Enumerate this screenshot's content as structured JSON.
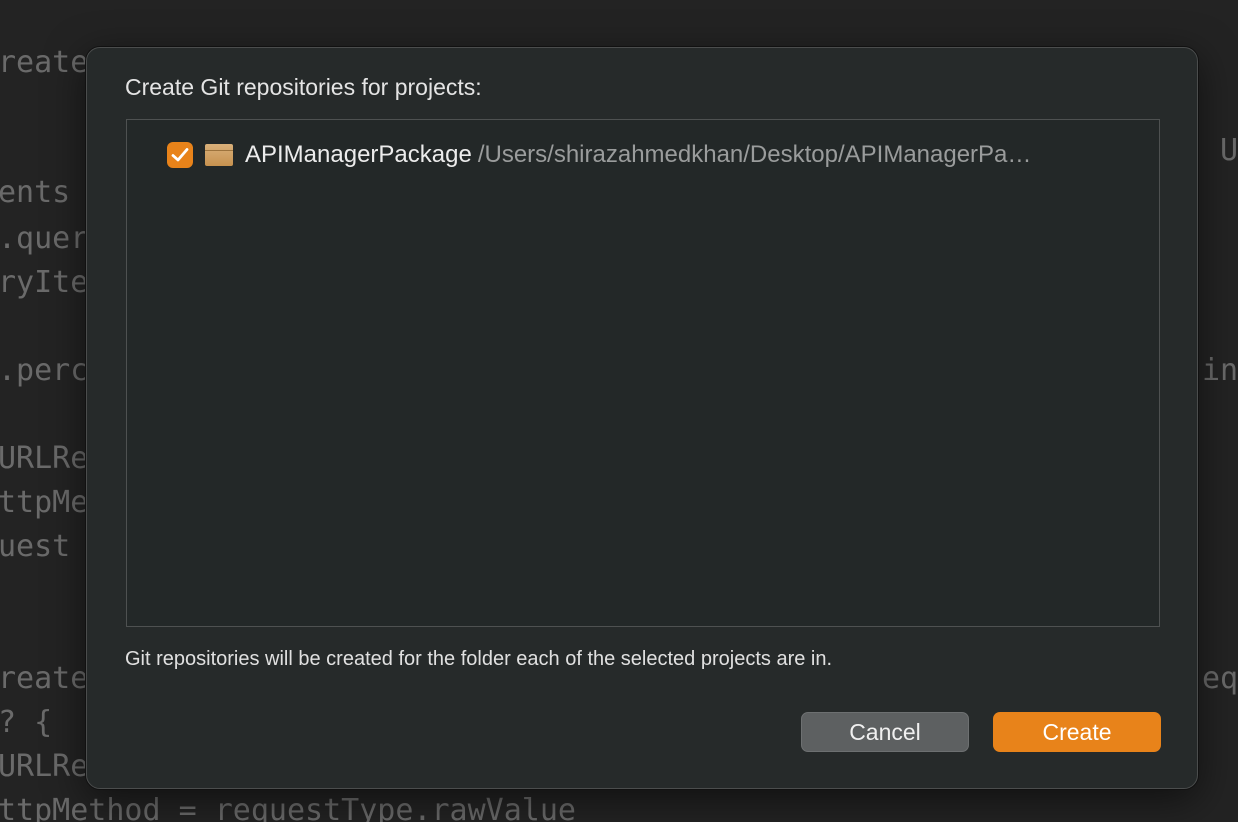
{
  "background_code": {
    "lines": [
      {
        "text": "reate"
      },
      {
        "text": "ents"
      },
      {
        "text": ".quer"
      },
      {
        "text": "ryIte"
      },
      {
        "text": ".perc"
      },
      {
        "text": "URLRe"
      },
      {
        "text": "ttpMe"
      },
      {
        "text": "uest"
      },
      {
        "text": "reate"
      },
      {
        "text": "? {"
      },
      {
        "text": "URLRe"
      },
      {
        "text": "ttpMethod = requestType.rawValue"
      }
    ],
    "right_fragments": [
      {
        "text": "U"
      },
      {
        "text": "in"
      },
      {
        "text": "eq"
      }
    ]
  },
  "dialog": {
    "title": "Create Git repositories for projects:",
    "projects": [
      {
        "checked": true,
        "icon": "package-icon",
        "name": "APIManagerPackage",
        "path": "/Users/shirazahmedkhan/Desktop/APIManagerPa…"
      }
    ],
    "info_text": "Git repositories will be created for the folder each of the selected projects are in.",
    "buttons": {
      "cancel_label": "Cancel",
      "create_label": "Create"
    }
  },
  "colors": {
    "accent": "#e8831a",
    "dialog_bg": "#262a2a",
    "list_bg": "#232828",
    "cancel_bg": "#5d6061"
  }
}
